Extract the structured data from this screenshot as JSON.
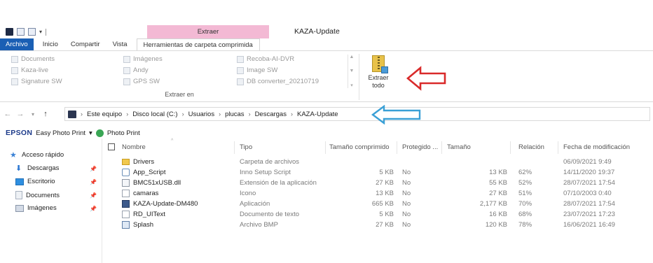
{
  "ribbon_tabs": {
    "file": "Archivo",
    "home": "Inicio",
    "share": "Compartir",
    "view": "Vista",
    "context_group": "Extraer",
    "context_tab": "Herramientas de carpeta comprimida"
  },
  "window_title": "KAZA-Update",
  "extract_to": {
    "destinations": [
      "Documents",
      "Kaza-live",
      "Signature SW",
      "Imágenes",
      "Andy",
      "GPS SW",
      "Recoba-AI-DVR",
      "Image SW",
      "DB converter_20210719"
    ],
    "caption": "Extraer en"
  },
  "extract_all": {
    "line1": "Extraer",
    "line2": "todo"
  },
  "address": {
    "crumbs": [
      "Este equipo",
      "Disco local (C:)",
      "Usuarios",
      "plucas",
      "Descargas",
      "KAZA-Update"
    ]
  },
  "epson_toolbar": {
    "logo": "EPSON",
    "easy_photo_print": "Easy Photo Print",
    "dropdown": "▾",
    "photo_print": "Photo Print"
  },
  "nav_pane": {
    "items": [
      {
        "label": "Acceso rápido",
        "icon": "star-icon",
        "pinned": false
      },
      {
        "label": "Descargas",
        "icon": "download-icon",
        "pinned": true
      },
      {
        "label": "Escritorio",
        "icon": "desktop-icon",
        "pinned": true
      },
      {
        "label": "Documents",
        "icon": "document-icon",
        "pinned": true
      },
      {
        "label": "Imágenes",
        "icon": "pictures-icon",
        "pinned": true
      }
    ]
  },
  "columns": {
    "name": "Nombre",
    "type": "Tipo",
    "compressed": "Tamaño comprimido",
    "protected": "Protegido ...",
    "size": "Tamaño",
    "ratio": "Relación",
    "modified": "Fecha de modificación"
  },
  "files": [
    {
      "name": "Drivers",
      "icon": "folder-icon",
      "type": "Carpeta de archivos",
      "compressed": "",
      "protected": "",
      "size": "",
      "ratio": "",
      "modified": "06/09/2021 9:49"
    },
    {
      "name": "App_Script",
      "icon": "script-icon",
      "type": "Inno Setup Script",
      "compressed": "5 KB",
      "protected": "No",
      "size": "13 KB",
      "ratio": "62%",
      "modified": "14/11/2020 19:37"
    },
    {
      "name": "BMC51xUSB.dll",
      "icon": "dll-icon",
      "type": "Extensión de la aplicación",
      "compressed": "27 KB",
      "protected": "No",
      "size": "55 KB",
      "ratio": "52%",
      "modified": "28/07/2021 17:54"
    },
    {
      "name": "camaras",
      "icon": "ico-file-icon",
      "type": "Icono",
      "compressed": "13 KB",
      "protected": "No",
      "size": "27 KB",
      "ratio": "51%",
      "modified": "07/10/2003 0:40"
    },
    {
      "name": "KAZA-Update-DM480",
      "icon": "application-icon",
      "type": "Aplicación",
      "compressed": "665 KB",
      "protected": "No",
      "size": "2,177 KB",
      "ratio": "70%",
      "modified": "28/07/2021 17:54"
    },
    {
      "name": "RD_UIText",
      "icon": "text-file-icon",
      "type": "Documento de texto",
      "compressed": "5 KB",
      "protected": "No",
      "size": "16 KB",
      "ratio": "68%",
      "modified": "23/07/2021 17:23"
    },
    {
      "name": "Splash",
      "icon": "bitmap-icon",
      "type": "Archivo BMP",
      "compressed": "27 KB",
      "protected": "No",
      "size": "120 KB",
      "ratio": "78%",
      "modified": "16/06/2021 16:49"
    }
  ],
  "colors": {
    "file_tab": "#1a5fb4",
    "context_group": "#f3b9d4",
    "red_arrow": "#d92a2a",
    "blue_arrow": "#3aa0d6"
  }
}
